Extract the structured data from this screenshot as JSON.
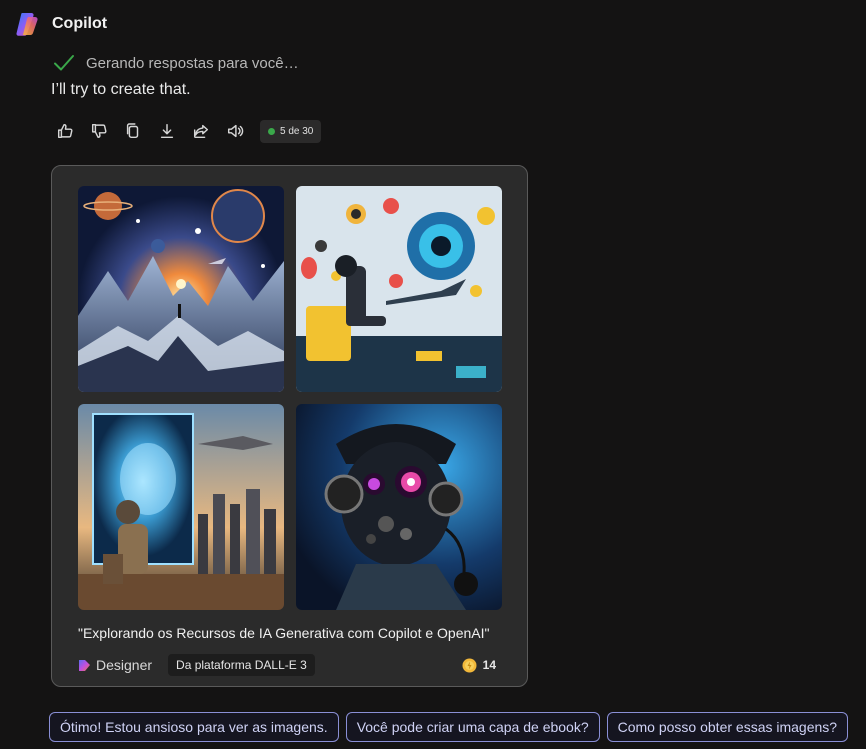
{
  "app": {
    "title": "Copilot"
  },
  "status": {
    "text": "Gerando respostas para você…",
    "color": "#3aa84a"
  },
  "message": {
    "text": "I’ll try to create that."
  },
  "actions": {
    "icons": [
      "thumbs-up-icon",
      "thumbs-down-icon",
      "copy-icon",
      "download-icon",
      "share-icon",
      "speaker-icon"
    ],
    "counter": "5 de 30"
  },
  "card": {
    "caption": "\"Explorando os Recursos de IA Generativa com Copilot e OpenAI\"",
    "designer_label": "Designer",
    "platform_label": "Da plataforma DALL-E 3",
    "credits": "14",
    "images": [
      "mountain-space-scene",
      "pilot-eye-gears-scene",
      "holographic-ai-city-scene",
      "robot-pilot-portrait"
    ]
  },
  "suggestions": [
    "Ótimo! Estou ansioso para ver as imagens.",
    "Você pode criar uma capa de ebook?",
    "Como posso obter essas imagens?"
  ],
  "colors": {
    "background": "#141313",
    "card": "#2b2b2b",
    "chip_border": "#8a8fd6"
  }
}
